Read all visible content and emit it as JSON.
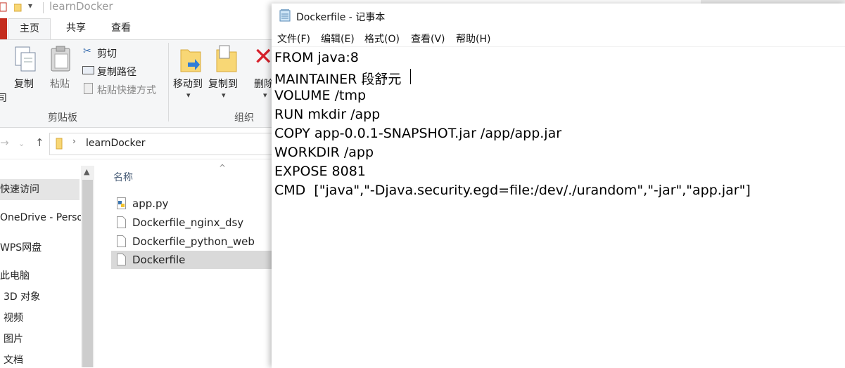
{
  "explorer": {
    "title": "learnDocker",
    "ribbon_tabs": [
      "主页",
      "共享",
      "查看"
    ],
    "clipboard": {
      "copy": "复制",
      "paste": "粘贴",
      "cut": "剪切",
      "copy_path": "复制路径",
      "paste_shortcut": "粘贴快捷方式",
      "group_label": "剪贴板",
      "cut_off_left": "司"
    },
    "organize": {
      "move_to": "移动到",
      "copy_to": "复制到",
      "delete": "删除",
      "group_label": "组织"
    },
    "address": {
      "folder": "learnDocker"
    },
    "nav_items": [
      "快速访问",
      "OneDrive - Perso",
      "WPS网盘",
      "此电脑",
      "3D 对象",
      "视频",
      "图片",
      "文档"
    ],
    "column_header": "名称",
    "files": [
      {
        "name": "app.py",
        "icon": "python-file-icon"
      },
      {
        "name": "Dockerfile_nginx_dsy",
        "icon": "blank-file-icon"
      },
      {
        "name": "Dockerfile_python_web",
        "icon": "blank-file-icon"
      },
      {
        "name": "Dockerfile",
        "icon": "blank-file-icon"
      }
    ]
  },
  "notepad": {
    "title": "Dockerfile - 记事本",
    "menu": [
      "文件(F)",
      "编辑(E)",
      "格式(O)",
      "查看(V)",
      "帮助(H)"
    ],
    "lines": [
      "FROM java:8",
      "MAINTAINER 段舒元",
      "VOLUME /tmp",
      "RUN mkdir /app",
      "COPY app-0.0.1-SNAPSHOT.jar /app/app.jar",
      "WORKDIR /app",
      "EXPOSE 8081",
      "CMD  [\"java\",\"-Djava.security.egd=file:/dev/./urandom\",\"-jar\",\"app.jar\"]"
    ]
  },
  "colors": {
    "file_tab": "#c42b1c",
    "selection": "#d9d9d9",
    "folder": "#f8d775"
  }
}
